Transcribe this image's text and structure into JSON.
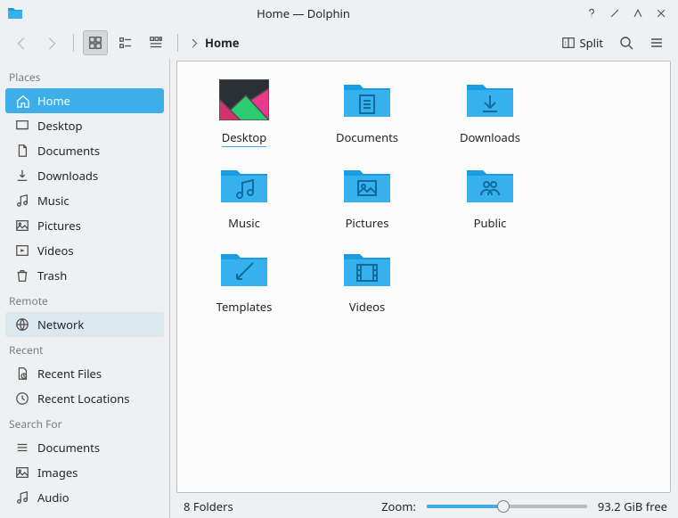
{
  "window": {
    "title": "Home — Dolphin"
  },
  "toolbar": {
    "breadcrumb": "Home",
    "split_label": "Split"
  },
  "sidebar": {
    "sections": [
      {
        "heading": "Places",
        "items": [
          {
            "label": "Home",
            "icon": "home-icon",
            "selected": true
          },
          {
            "label": "Desktop",
            "icon": "desktop-icon"
          },
          {
            "label": "Documents",
            "icon": "documents-icon"
          },
          {
            "label": "Downloads",
            "icon": "downloads-icon"
          },
          {
            "label": "Music",
            "icon": "music-icon"
          },
          {
            "label": "Pictures",
            "icon": "pictures-icon"
          },
          {
            "label": "Videos",
            "icon": "videos-icon"
          },
          {
            "label": "Trash",
            "icon": "trash-icon"
          }
        ]
      },
      {
        "heading": "Remote",
        "items": [
          {
            "label": "Network",
            "icon": "network-icon",
            "hovered": true
          }
        ]
      },
      {
        "heading": "Recent",
        "items": [
          {
            "label": "Recent Files",
            "icon": "recent-files-icon"
          },
          {
            "label": "Recent Locations",
            "icon": "recent-locations-icon"
          }
        ]
      },
      {
        "heading": "Search For",
        "items": [
          {
            "label": "Documents",
            "icon": "search-docs-icon"
          },
          {
            "label": "Images",
            "icon": "search-images-icon"
          },
          {
            "label": "Audio",
            "icon": "search-audio-icon"
          }
        ]
      }
    ]
  },
  "files": [
    {
      "label": "Desktop",
      "type": "desktop",
      "selected": true
    },
    {
      "label": "Documents",
      "type": "documents"
    },
    {
      "label": "Downloads",
      "type": "downloads"
    },
    {
      "label": "Music",
      "type": "music"
    },
    {
      "label": "Pictures",
      "type": "pictures"
    },
    {
      "label": "Public",
      "type": "public"
    },
    {
      "label": "Templates",
      "type": "templates"
    },
    {
      "label": "Videos",
      "type": "videos"
    }
  ],
  "status": {
    "summary": "8 Folders",
    "zoom_label": "Zoom:",
    "zoom_pct": 48,
    "free": "93.2 GiB free"
  },
  "colors": {
    "accent": "#3daee9",
    "bg": "#eff0f1",
    "viewport": "#fcfcfc"
  }
}
